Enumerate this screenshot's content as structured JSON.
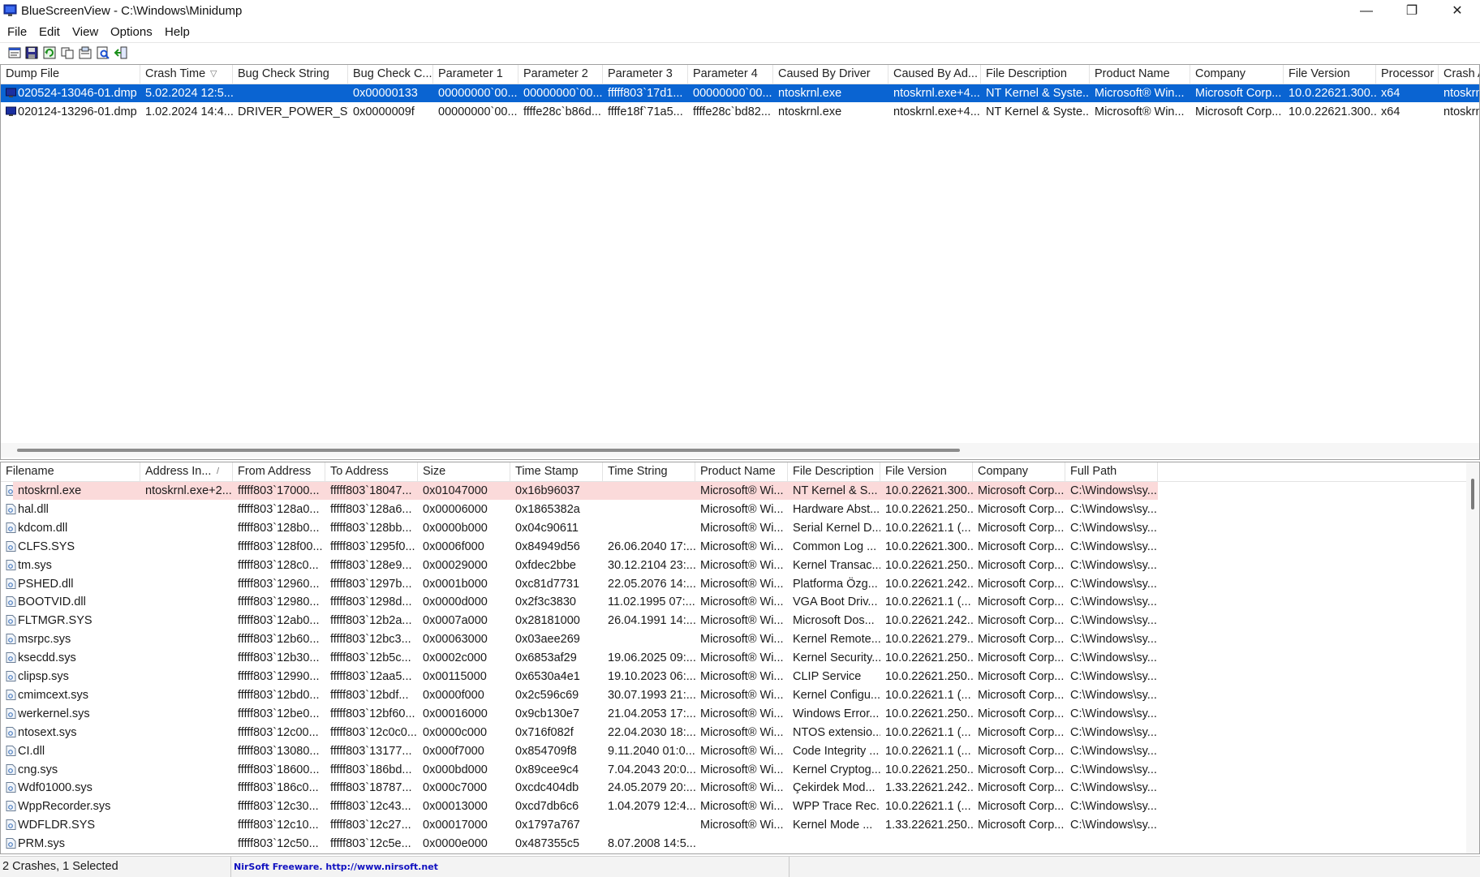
{
  "window": {
    "title": "BlueScreenView  -  C:\\Windows\\Minidump",
    "minimize": "—",
    "restore": "❐",
    "close": "✕"
  },
  "menu": [
    "File",
    "Edit",
    "View",
    "Options",
    "Help"
  ],
  "toolbar": {
    "icons": [
      "properties-icon",
      "save-icon",
      "refresh-icon",
      "copy-icon",
      "report-icon",
      "find-icon",
      "exit-icon"
    ]
  },
  "upper": {
    "columns": [
      "Dump File",
      "Crash Time",
      "Bug Check String",
      "Bug Check C...",
      "Parameter 1",
      "Parameter 2",
      "Parameter 3",
      "Parameter 4",
      "Caused By Driver",
      "Caused By Ad...",
      "File Description",
      "Product Name",
      "Company",
      "File Version",
      "Processor",
      "Crash Ad"
    ],
    "sort_indicator": "▽",
    "rows": [
      [
        "020524-13046-01.dmp",
        "5.02.2024 12:5...",
        "",
        "0x00000133",
        "00000000`00...",
        "00000000`00...",
        "fffff803`17d1...",
        "00000000`00...",
        "ntoskrnl.exe",
        "ntoskrnl.exe+4...",
        "NT Kernel & Syste...",
        "Microsoft® Win...",
        "Microsoft Corp...",
        "10.0.22621.300...",
        "x64",
        "ntoskrnl"
      ],
      [
        "020124-13296-01.dmp",
        "1.02.2024 14:4...",
        "DRIVER_POWER_ST...",
        "0x0000009f",
        "00000000`00...",
        "ffffe28c`b86d...",
        "ffffe18f`71a5...",
        "ffffe28c`bd82...",
        "ntoskrnl.exe",
        "ntoskrnl.exe+4...",
        "NT Kernel & Syste...",
        "Microsoft® Win...",
        "Microsoft Corp...",
        "10.0.22621.300...",
        "x64",
        "ntoskrnl"
      ]
    ]
  },
  "lower": {
    "columns": [
      "Filename",
      "Address In...",
      "From Address",
      "To Address",
      "Size",
      "Time Stamp",
      "Time String",
      "Product Name",
      "File Description",
      "File Version",
      "Company",
      "Full Path"
    ],
    "sort_indicator": "/",
    "rows": [
      [
        "ntoskrnl.exe",
        "ntoskrnl.exe+2...",
        "fffff803`17000...",
        "fffff803`18047...",
        "0x01047000",
        "0x16b96037",
        "",
        "Microsoft® Wi...",
        "NT Kernel & S...",
        "10.0.22621.300...",
        "Microsoft Corp...",
        "C:\\Windows\\sy..."
      ],
      [
        "hal.dll",
        "",
        "fffff803`128a0...",
        "fffff803`128a6...",
        "0x00006000",
        "0x1865382a",
        "",
        "Microsoft® Wi...",
        "Hardware Abst...",
        "10.0.22621.250...",
        "Microsoft Corp...",
        "C:\\Windows\\sy..."
      ],
      [
        "kdcom.dll",
        "",
        "fffff803`128b0...",
        "fffff803`128bb...",
        "0x0000b000",
        "0x04c90611",
        "",
        "Microsoft® Wi...",
        "Serial Kernel D...",
        "10.0.22621.1 (...",
        "Microsoft Corp...",
        "C:\\Windows\\sy..."
      ],
      [
        "CLFS.SYS",
        "",
        "fffff803`128f00...",
        "fffff803`1295f0...",
        "0x0006f000",
        "0x84949d56",
        "26.06.2040 17:...",
        "Microsoft® Wi...",
        "Common Log ...",
        "10.0.22621.300...",
        "Microsoft Corp...",
        "C:\\Windows\\sy..."
      ],
      [
        "tm.sys",
        "",
        "fffff803`128c0...",
        "fffff803`128e9...",
        "0x00029000",
        "0xfdec2bbe",
        "30.12.2104 23:...",
        "Microsoft® Wi...",
        "Kernel Transac...",
        "10.0.22621.250...",
        "Microsoft Corp...",
        "C:\\Windows\\sy..."
      ],
      [
        "PSHED.dll",
        "",
        "fffff803`12960...",
        "fffff803`1297b...",
        "0x0001b000",
        "0xc81d7731",
        "22.05.2076 14:...",
        "Microsoft® Wi...",
        "Platforma Özg...",
        "10.0.22621.242...",
        "Microsoft Corp...",
        "C:\\Windows\\sy..."
      ],
      [
        "BOOTVID.dll",
        "",
        "fffff803`12980...",
        "fffff803`1298d...",
        "0x0000d000",
        "0x2f3c3830",
        "11.02.1995 07:...",
        "Microsoft® Wi...",
        "VGA Boot Driv...",
        "10.0.22621.1 (...",
        "Microsoft Corp...",
        "C:\\Windows\\sy..."
      ],
      [
        "FLTMGR.SYS",
        "",
        "fffff803`12ab0...",
        "fffff803`12b2a...",
        "0x0007a000",
        "0x28181000",
        "26.04.1991 14:...",
        "Microsoft® Wi...",
        "Microsoft Dos...",
        "10.0.22621.242...",
        "Microsoft Corp...",
        "C:\\Windows\\sy..."
      ],
      [
        "msrpc.sys",
        "",
        "fffff803`12b60...",
        "fffff803`12bc3...",
        "0x00063000",
        "0x03aee269",
        "",
        "Microsoft® Wi...",
        "Kernel Remote...",
        "10.0.22621.279...",
        "Microsoft Corp...",
        "C:\\Windows\\sy..."
      ],
      [
        "ksecdd.sys",
        "",
        "fffff803`12b30...",
        "fffff803`12b5c...",
        "0x0002c000",
        "0x6853af29",
        "19.06.2025 09:...",
        "Microsoft® Wi...",
        "Kernel Security...",
        "10.0.22621.250...",
        "Microsoft Corp...",
        "C:\\Windows\\sy..."
      ],
      [
        "clipsp.sys",
        "",
        "fffff803`12990...",
        "fffff803`12aa5...",
        "0x00115000",
        "0x6530a4e1",
        "19.10.2023 06:...",
        "Microsoft® Wi...",
        "CLIP Service",
        "10.0.22621.250...",
        "Microsoft Corp...",
        "C:\\Windows\\sy..."
      ],
      [
        "cmimcext.sys",
        "",
        "fffff803`12bd0...",
        "fffff803`12bdf...",
        "0x0000f000",
        "0x2c596c69",
        "30.07.1993 21:...",
        "Microsoft® Wi...",
        "Kernel Configu...",
        "10.0.22621.1 (...",
        "Microsoft Corp...",
        "C:\\Windows\\sy..."
      ],
      [
        "werkernel.sys",
        "",
        "fffff803`12be0...",
        "fffff803`12bf60...",
        "0x00016000",
        "0x9cb130e7",
        "21.04.2053 17:...",
        "Microsoft® Wi...",
        "Windows Error...",
        "10.0.22621.250...",
        "Microsoft Corp...",
        "C:\\Windows\\sy..."
      ],
      [
        "ntosext.sys",
        "",
        "fffff803`12c00...",
        "fffff803`12c0c0...",
        "0x0000c000",
        "0x716f082f",
        "22.04.2030 18:...",
        "Microsoft® Wi...",
        "NTOS extensio...",
        "10.0.22621.1 (...",
        "Microsoft Corp...",
        "C:\\Windows\\sy..."
      ],
      [
        "CI.dll",
        "",
        "fffff803`13080...",
        "fffff803`13177...",
        "0x000f7000",
        "0x854709f8",
        "9.11.2040 01:0...",
        "Microsoft® Wi...",
        "Code Integrity ...",
        "10.0.22621.1 (...",
        "Microsoft Corp...",
        "C:\\Windows\\sy..."
      ],
      [
        "cng.sys",
        "",
        "fffff803`18600...",
        "fffff803`186bd...",
        "0x000bd000",
        "0x89cee9c4",
        "7.04.2043 20:0...",
        "Microsoft® Wi...",
        "Kernel Cryptog...",
        "10.0.22621.250...",
        "Microsoft Corp...",
        "C:\\Windows\\sy..."
      ],
      [
        "Wdf01000.sys",
        "",
        "fffff803`186c0...",
        "fffff803`18787...",
        "0x000c7000",
        "0xcdc404db",
        "24.05.2079 20:...",
        "Microsoft® Wi...",
        "Çekirdek Mod...",
        "1.33.22621.242...",
        "Microsoft Corp...",
        "C:\\Windows\\sy..."
      ],
      [
        "WppRecorder.sys",
        "",
        "fffff803`12c30...",
        "fffff803`12c43...",
        "0x00013000",
        "0xcd7db6c6",
        "1.04.2079 12:4...",
        "Microsoft® Wi...",
        "WPP Trace Rec...",
        "10.0.22621.1 (...",
        "Microsoft Corp...",
        "C:\\Windows\\sy..."
      ],
      [
        "WDFLDR.SYS",
        "",
        "fffff803`12c10...",
        "fffff803`12c27...",
        "0x00017000",
        "0x1797a767",
        "",
        "Microsoft® Wi...",
        "Kernel Mode ...",
        "1.33.22621.250...",
        "Microsoft Corp...",
        "C:\\Windows\\sy..."
      ],
      [
        "PRM.sys",
        "",
        "fffff803`12c50...",
        "fffff803`12c5e...",
        "0x0000e000",
        "0x487355c5",
        "8.07.2008 14:5...",
        "",
        "",
        "",
        "",
        ""
      ]
    ]
  },
  "status": {
    "count": "2 Crashes, 1 Selected",
    "freeware": "NirSoft Freeware.  http://www.nirsoft.net"
  },
  "colors": {
    "selection": "#0a64d2",
    "highlight_row": "#fbdada",
    "link": "#1010c0"
  }
}
